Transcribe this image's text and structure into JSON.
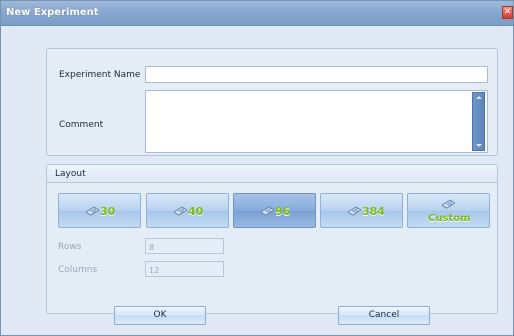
{
  "window": {
    "title": "New Experiment",
    "close_glyph": "✕"
  },
  "form": {
    "experiment_name_label": "Experiment Name",
    "experiment_name_value": "",
    "comment_label": "Comment",
    "comment_value": ""
  },
  "layout": {
    "header": "Layout",
    "options": [
      {
        "label": "30",
        "icon": "well-plate-icon",
        "selected": false
      },
      {
        "label": "40",
        "icon": "well-plate-icon",
        "selected": false
      },
      {
        "label": "96",
        "icon": "well-plate-icon",
        "selected": true
      },
      {
        "label": "384",
        "icon": "well-plate-icon",
        "selected": false
      },
      {
        "label": "Custom",
        "icon": "well-plate-icon",
        "selected": false
      }
    ],
    "rows_label": "Rows",
    "rows_value": "8",
    "columns_label": "Columns",
    "columns_value": "12"
  },
  "buttons": {
    "ok": "OK",
    "cancel": "Cancel"
  },
  "colors": {
    "accent_green": "#7dbb1e",
    "title_bar": "#88a7cf",
    "dialog_bg": "#dfe8f3"
  }
}
